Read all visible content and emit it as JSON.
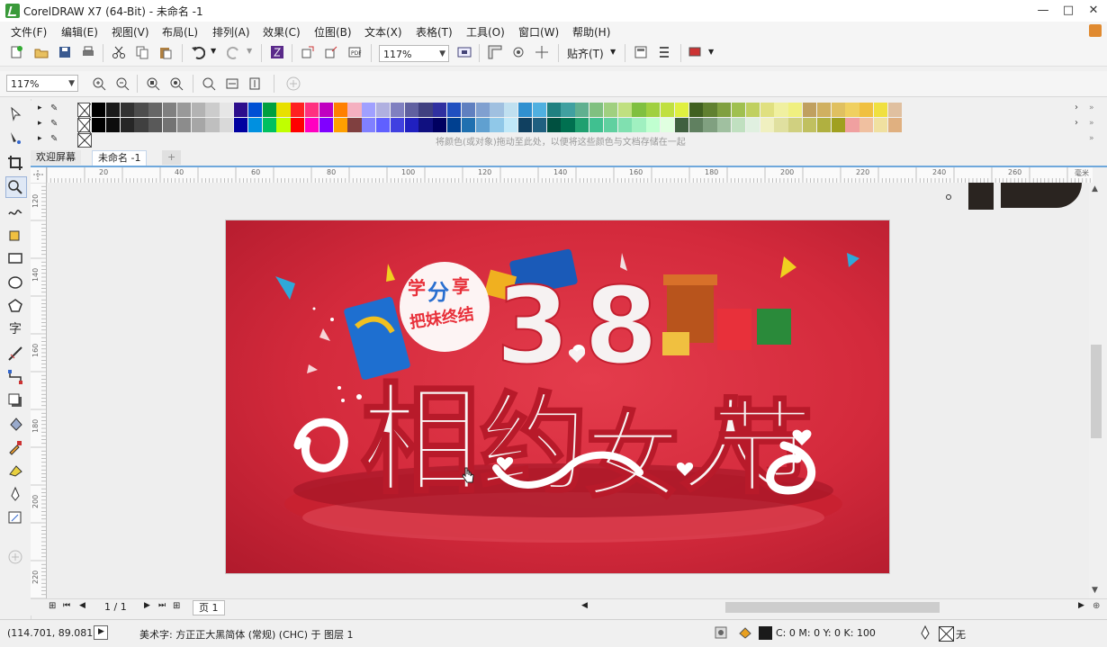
{
  "window": {
    "title": "CorelDRAW X7 (64-Bit) - 未命名 -1",
    "minimize": "—",
    "maximize": "□",
    "close": "✕"
  },
  "menu": [
    "文件(F)",
    "编辑(E)",
    "视图(V)",
    "布局(L)",
    "排列(A)",
    "效果(C)",
    "位图(B)",
    "文本(X)",
    "表格(T)",
    "工具(O)",
    "窗口(W)",
    "帮助(H)"
  ],
  "toolbar": {
    "zoom_value": "117%",
    "snap_label": "贴齐(T)"
  },
  "property_bar": {
    "zoom_value": "117%"
  },
  "palette": {
    "hint": "将颜色(或对象)拖动至此处，以便将这些颜色与文档存储在一起",
    "row1": [
      "#000000",
      "#1a1a1a",
      "#333333",
      "#4d4d4d",
      "#666666",
      "#808080",
      "#999999",
      "#b3b3b3",
      "#cccccc",
      "#e6e6e6",
      "#2d0e8c",
      "#0050d4",
      "#00a040",
      "#e8e000",
      "#ff2020",
      "#ff3080",
      "#c000c0",
      "#ff8000",
      "#f4b0c0",
      "#a0a0ff",
      "#b0b0e0",
      "#8080c0",
      "#6060a0",
      "#404080",
      "#3030a0",
      "#2050c0",
      "#6080c0",
      "#80a0d0",
      "#a0c0e0",
      "#c0e0f0",
      "#3090d0",
      "#50b0e0",
      "#208080",
      "#40a0a0",
      "#60b090",
      "#80c080",
      "#a0d080",
      "#c0e080",
      "#80c040",
      "#a0d040",
      "#c0e040",
      "#e0f040",
      "#406020",
      "#608030",
      "#80a040",
      "#a0c050",
      "#c0d060",
      "#e0e080",
      "#f0f0a0",
      "#f0f080",
      "#c0a060",
      "#d0b060",
      "#e0c060",
      "#f0d060",
      "#f0c040",
      "#f0e040",
      "#e0c0a0"
    ],
    "row2": [
      "#000000",
      "#0d0d0d",
      "#262626",
      "#404040",
      "#595959",
      "#737373",
      "#8c8c8c",
      "#a6a6a6",
      "#bfbfbf",
      "#d9d9d9",
      "#0000a0",
      "#0090e0",
      "#00c060",
      "#c0ff00",
      "#ff0000",
      "#ff00c0",
      "#8000ff",
      "#ffa000",
      "#804040",
      "#8080ff",
      "#6060ff",
      "#4040e0",
      "#2020c0",
      "#101080",
      "#000060",
      "#004090",
      "#2070b0",
      "#60a0d0",
      "#90c8e8",
      "#c0e8f8",
      "#104060",
      "#206080",
      "#005040",
      "#007050",
      "#20a070",
      "#40c090",
      "#60d0a0",
      "#80e0b0",
      "#a0f0c0",
      "#c0ffd0",
      "#e0ffe0",
      "#406040",
      "#608060",
      "#80a080",
      "#a0c0a0",
      "#c0e0c0",
      "#e0f0e0",
      "#f0f0c0",
      "#e0e0a0",
      "#d0d080",
      "#c0c060",
      "#b0b040",
      "#a0a020",
      "#f0a0a0",
      "#f0c0a0",
      "#f0e0a0",
      "#e0b080"
    ]
  },
  "tabs": [
    "欢迎屏幕",
    "未命名 -1"
  ],
  "ruler_labels_h": [
    "20",
    "40",
    "60",
    "80",
    "100",
    "120",
    "140",
    "160",
    "180",
    "200",
    "220",
    "240",
    "260",
    "毫米"
  ],
  "ruler_labels_v": [
    "120",
    "140",
    "160",
    "180",
    "200",
    "220",
    "240"
  ],
  "artwork": {
    "tag_text": "学习分享 把妹终结",
    "big_number": "3.8",
    "headline": "相约女人节"
  },
  "page_nav": {
    "page_indicator": "1 / 1",
    "page_tab": "页 1"
  },
  "status": {
    "coordinates": "(114.701, 89.081 )",
    "object_info": "美术字: 方正正大黑简体 (常规) (CHC) 于 图层 1",
    "fill_info": "C: 0 M: 0 Y: 0 K: 100",
    "outline_info": "无"
  },
  "colors": {
    "poster_bg": "#d42a3c",
    "accent_blue": "#2f6fb3"
  }
}
